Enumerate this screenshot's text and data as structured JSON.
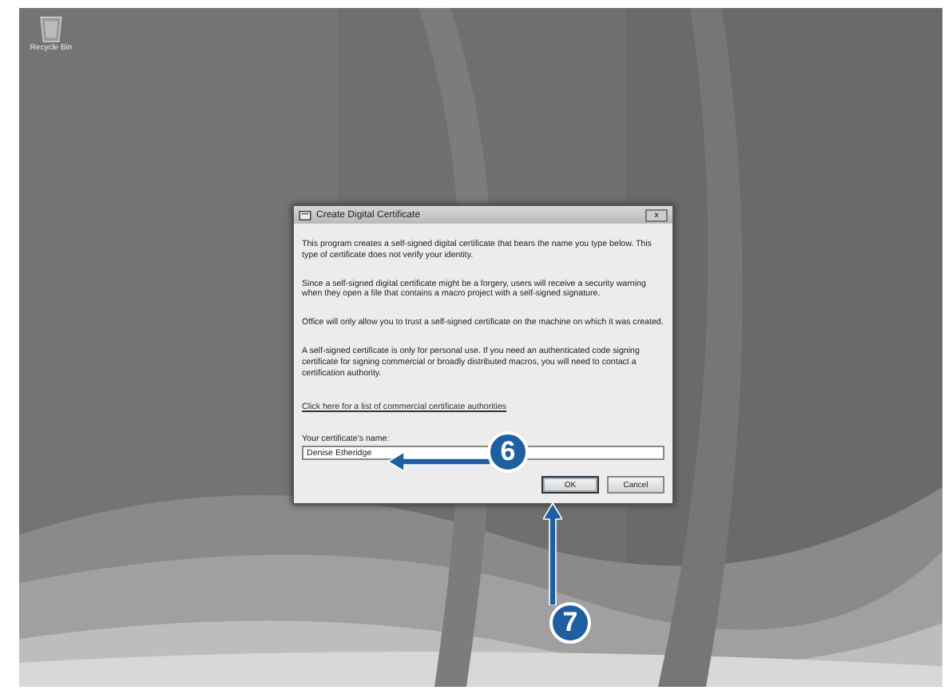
{
  "desktop": {
    "icons": [
      {
        "label": "Recycle Bin"
      }
    ]
  },
  "dialog": {
    "title": "Create Digital Certificate",
    "close": "x",
    "paragraphs": [
      "This program creates a self-signed digital certificate that bears the name you type below. This type of certificate does not verify your identity.",
      "Since a self-signed digital certificate might be a forgery, users will receive a security warning when they open a file that contains a macro project with a self-signed signature.",
      "Office will only allow you to trust a self-signed certificate on the machine on which it was created.",
      "A self-signed certificate is only for personal use. If you need an authenticated code signing certificate for signing commercial or broadly distributed macros, you will need to contact a certification authority."
    ],
    "link": "Click here for a list of commercial certificate authorities",
    "name_label": "Your certificate's name:",
    "name_value": "Denise Etheridge",
    "buttons": [
      {
        "label": "OK",
        "selected": true
      },
      {
        "label": "Cancel",
        "selected": false
      }
    ]
  },
  "callouts": [
    {
      "number": "6",
      "kind": "left"
    },
    {
      "number": "7",
      "kind": "up"
    }
  ]
}
